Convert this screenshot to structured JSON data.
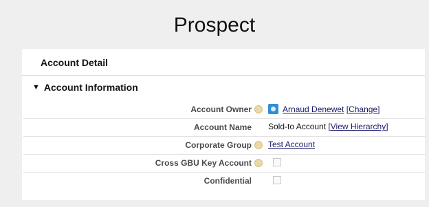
{
  "page": {
    "title": "Prospect"
  },
  "panel": {
    "title": "Account Detail",
    "section": {
      "title": "Account Information",
      "toggle_icon": "triangle-down-icon"
    }
  },
  "fields": {
    "account_owner": {
      "label": "Account Owner",
      "user_name": "Arnaud Denewet",
      "change_link": "[Change]"
    },
    "account_name": {
      "label": "Account Name",
      "value": "Sold-to Account",
      "hierarchy_link": "[View Hierarchy]"
    },
    "corporate_group": {
      "label": "Corporate Group",
      "value": "Test Account"
    },
    "cross_gbu_key_account": {
      "label": "Cross GBU Key Account",
      "checked": false
    },
    "confidential": {
      "label": "Confidential",
      "checked": false
    }
  },
  "colors": {
    "link": "#1a1a6a",
    "user_icon": "#2f8fd6",
    "help_icon": "#ecd9a8"
  }
}
